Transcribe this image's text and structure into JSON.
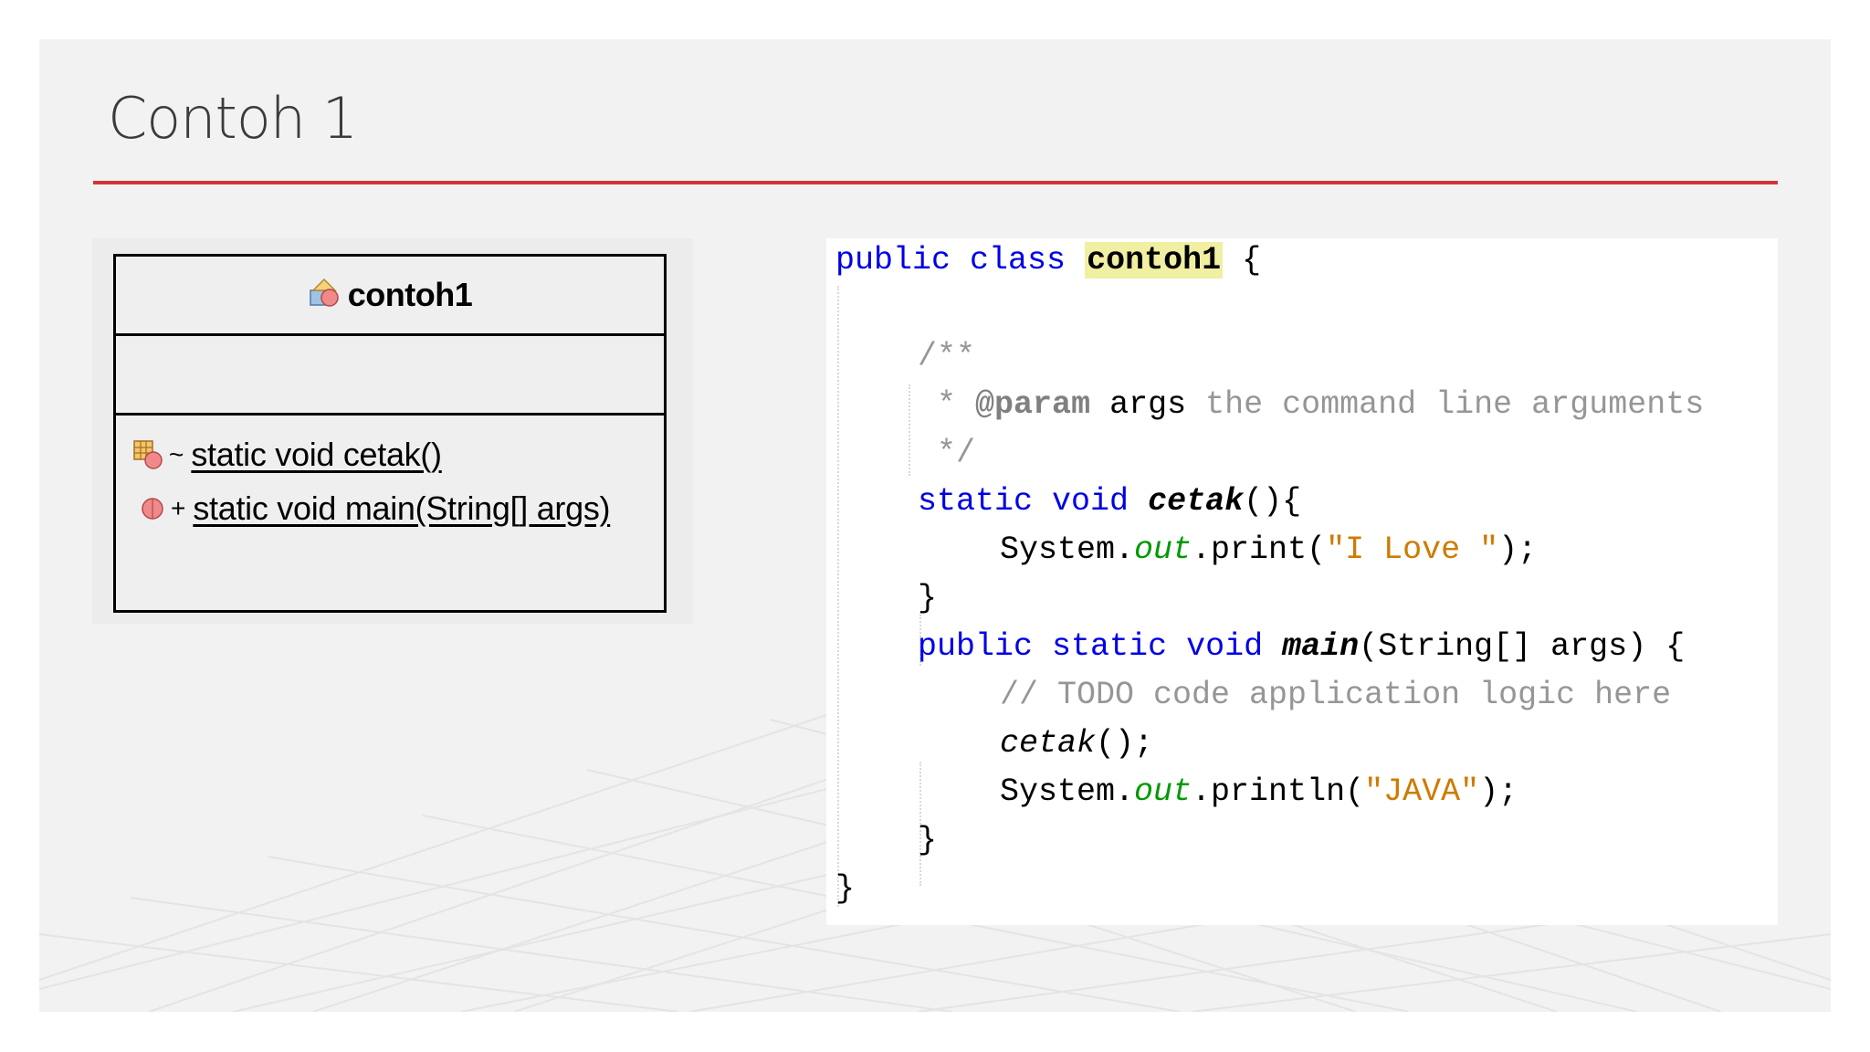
{
  "slide": {
    "title": "Contoh 1",
    "accent_color": "#d13438"
  },
  "uml": {
    "class_name": "contoh1",
    "class_icon": "class-icon",
    "operations": [
      {
        "icon": "package-method-icon",
        "visibility": "~",
        "signature": "static void cetak()"
      },
      {
        "icon": "public-method-icon",
        "visibility": "+",
        "signature": "static void main(String[] args)"
      }
    ]
  },
  "code": {
    "l1_public": "public",
    "l1_class": "class",
    "l1_name": "contoh1",
    "l1_brace": "{",
    "l3_comment": "/**",
    "l4_star": "*",
    "l4_tag": "@param",
    "l4_arg": "args",
    "l4_desc": "the command line arguments",
    "l5_comment": "*/",
    "l6_static": "static",
    "l6_void": "void",
    "l6_method": "cetak",
    "l6_rest": "(){",
    "l7_sys": "System.",
    "l7_out": "out",
    "l7_print": ".print(",
    "l7_str": "\"I Love \"",
    "l7_end": ");",
    "l8_brace": "}",
    "l9_public": "public",
    "l9_static": "static",
    "l9_void": "void",
    "l9_method": "main",
    "l9_params": "(String[] args) {",
    "l10_comment": "// TODO code application logic here",
    "l11_call": "cetak",
    "l11_end": "();",
    "l12_sys": "System.",
    "l12_out": "out",
    "l12_println": ".println(",
    "l12_str": "\"JAVA\"",
    "l12_end": ");",
    "l13_brace": "}",
    "l14_brace": "}",
    "colors": {
      "keyword": "#0000e6",
      "comment": "#969696",
      "string": "#ce7b00",
      "field": "#009900",
      "highlight": "#f0efa2"
    }
  }
}
